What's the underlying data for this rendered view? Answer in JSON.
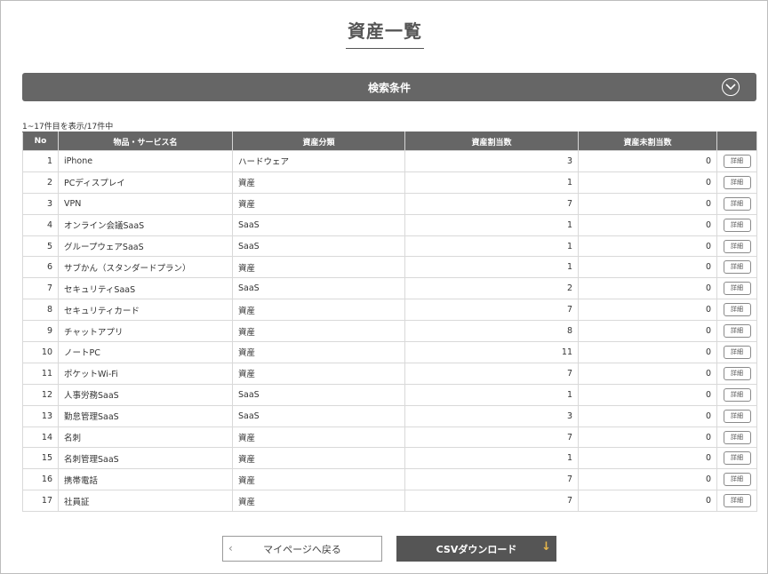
{
  "page": {
    "title": "資産一覧"
  },
  "search": {
    "label": "検索条件",
    "toggle_icon": "chevron-down-circle-icon"
  },
  "list": {
    "count_text": "1~17件目を表示/17件中"
  },
  "table": {
    "headers": [
      "No",
      "物品・サービス名",
      "資産分類",
      "資産割当数",
      "資産未割当数",
      ""
    ],
    "detail_label": "詳細",
    "rows": [
      {
        "no": "1",
        "name": "iPhone",
        "category": "ハードウェア",
        "assigned": "3",
        "unassigned": "0"
      },
      {
        "no": "2",
        "name": "PCディスプレイ",
        "category": "資産",
        "assigned": "1",
        "unassigned": "0"
      },
      {
        "no": "3",
        "name": "VPN",
        "category": "資産",
        "assigned": "7",
        "unassigned": "0"
      },
      {
        "no": "4",
        "name": "オンライン会議SaaS",
        "category": "SaaS",
        "assigned": "1",
        "unassigned": "0"
      },
      {
        "no": "5",
        "name": "グループウェアSaaS",
        "category": "SaaS",
        "assigned": "1",
        "unassigned": "0"
      },
      {
        "no": "6",
        "name": "サブかん（スタンダードプラン）",
        "category": "資産",
        "assigned": "1",
        "unassigned": "0"
      },
      {
        "no": "7",
        "name": "セキュリティSaaS",
        "category": "SaaS",
        "assigned": "2",
        "unassigned": "0"
      },
      {
        "no": "8",
        "name": "セキュリティカード",
        "category": "資産",
        "assigned": "7",
        "unassigned": "0"
      },
      {
        "no": "9",
        "name": "チャットアプリ",
        "category": "資産",
        "assigned": "8",
        "unassigned": "0"
      },
      {
        "no": "10",
        "name": "ノートPC",
        "category": "資産",
        "assigned": "11",
        "unassigned": "0"
      },
      {
        "no": "11",
        "name": "ポケットWi-Fi",
        "category": "資産",
        "assigned": "7",
        "unassigned": "0"
      },
      {
        "no": "12",
        "name": "人事労務SaaS",
        "category": "SaaS",
        "assigned": "1",
        "unassigned": "0"
      },
      {
        "no": "13",
        "name": "勤怠管理SaaS",
        "category": "SaaS",
        "assigned": "3",
        "unassigned": "0"
      },
      {
        "no": "14",
        "name": "名刺",
        "category": "資産",
        "assigned": "7",
        "unassigned": "0"
      },
      {
        "no": "15",
        "name": "名刺管理SaaS",
        "category": "資産",
        "assigned": "1",
        "unassigned": "0"
      },
      {
        "no": "16",
        "name": "携帯電話",
        "category": "資産",
        "assigned": "7",
        "unassigned": "0"
      },
      {
        "no": "17",
        "name": "社員証",
        "category": "資産",
        "assigned": "7",
        "unassigned": "0"
      }
    ]
  },
  "footer": {
    "back_label": "マイページへ戻る",
    "back_icon": "chevron-left-icon",
    "csv_label": "CSVダウンロード",
    "csv_icon": "download-arrow-icon",
    "csv_icon_color": "#e8b84b"
  }
}
